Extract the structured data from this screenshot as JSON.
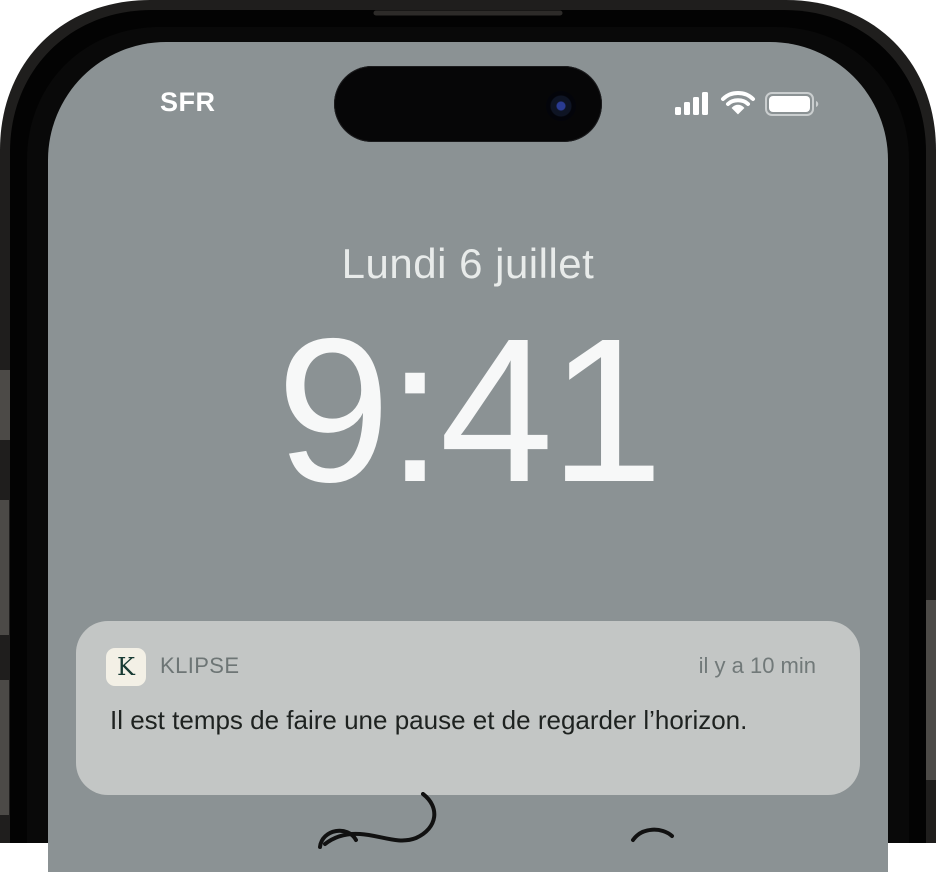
{
  "status_bar": {
    "carrier": "SFR",
    "signal_icon": "cellular-signal-icon",
    "wifi_icon": "wifi-icon",
    "battery_icon": "battery-icon"
  },
  "lock_screen": {
    "date": "Lundi 6 juillet",
    "time": "9:41"
  },
  "notification": {
    "app_icon_letter": "K",
    "app_name": "KLIPSE",
    "timestamp": "il y a 10 min",
    "message": "Il est temps de faire une pause et de regarder l’horizon."
  },
  "colors": {
    "wallpaper": "#8b9294",
    "notification_background": "#c3c6c5",
    "app_icon_background": "#f3f0e6",
    "app_icon_letter": "#173a33"
  }
}
